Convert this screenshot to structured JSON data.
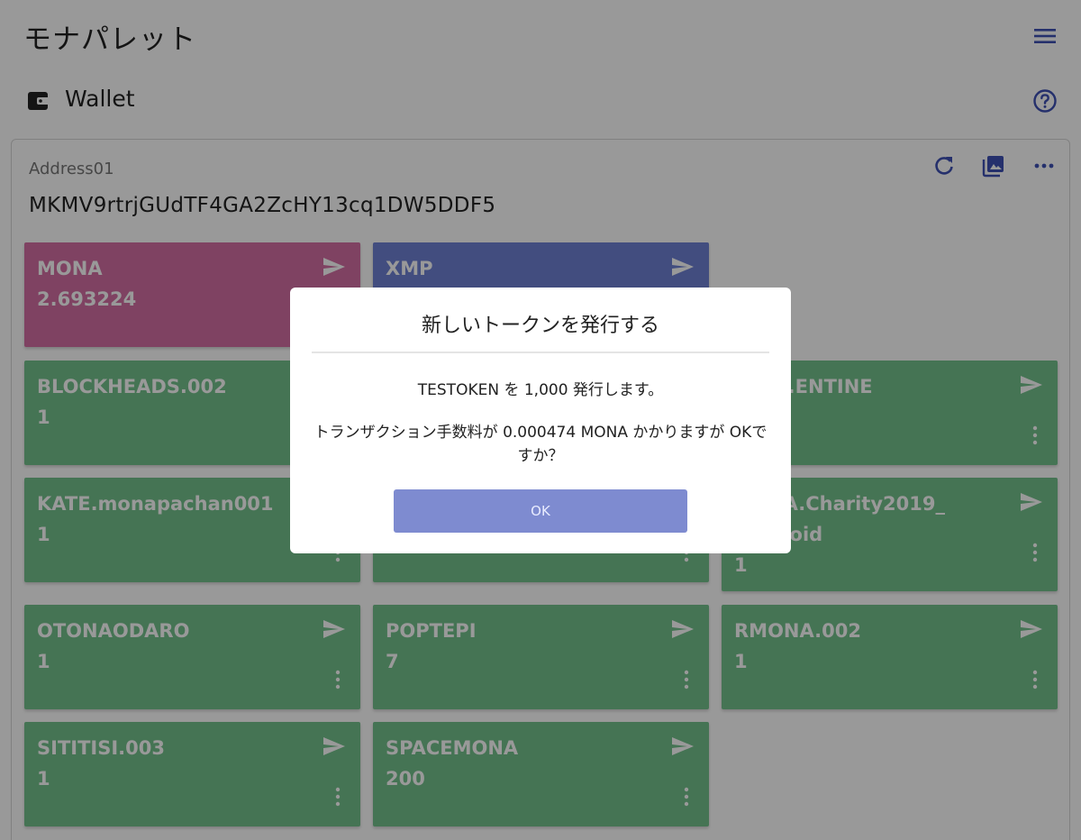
{
  "app": {
    "title": "モナパレット"
  },
  "header": {
    "label": "Wallet"
  },
  "card": {
    "address_name": "Address01",
    "address": "MKMV9rtrjGUdTF4GA2ZcHY13cq1DW5DDF5"
  },
  "tokens": [
    {
      "name": "MONA",
      "balance": "2.693224",
      "color": "#d46fa3"
    },
    {
      "name": "XMP",
      "balance": "",
      "color": "#6f80d4"
    },
    {
      "name": "BLOCKHEADS.002",
      "balance": "1",
      "color": "#73c18c"
    },
    {
      "name": "YVAL.ENTINE",
      "balance": "",
      "color": "#73c18c"
    },
    {
      "name": "KATE.monapachan001",
      "balance": "1",
      "color": "#73c18c"
    },
    {
      "name": "DAMA.Charity2019_",
      "name2": "ATiproid",
      "balance": "1",
      "color": "#73c18c"
    },
    {
      "name": "OTONAODARO",
      "balance": "1",
      "color": "#73c18c"
    },
    {
      "name": "POPTEPI",
      "balance": "7",
      "color": "#73c18c"
    },
    {
      "name": "RMONA.002",
      "balance": "1",
      "color": "#73c18c"
    },
    {
      "name": "SITITISI.003",
      "balance": "1",
      "color": "#73c18c"
    },
    {
      "name": "SPACEMONA",
      "balance": "200",
      "color": "#73c18c"
    }
  ],
  "dialog": {
    "title": "新しいトークンを発行する",
    "line1": "TESTOKEN を 1,000 発行します。",
    "line2": "トランザクション手数料が 0.000474 MONA かかりますが OKですか？",
    "ok_label": "OK"
  },
  "colors": {
    "accent": "#3f51b5",
    "mona": "#d46fa3",
    "xmp": "#6f80d4",
    "token": "#73c18c",
    "ok_button": "#7e8bd0"
  }
}
